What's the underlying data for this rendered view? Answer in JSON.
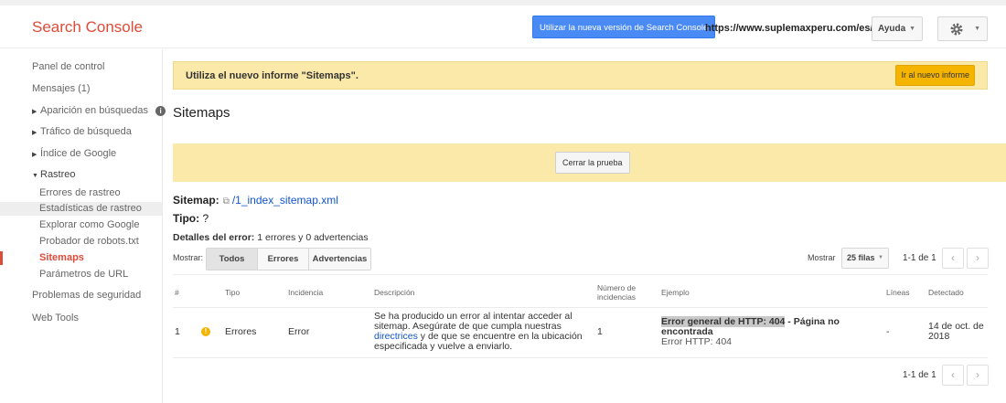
{
  "header": {
    "logo": "Search Console",
    "new_version_button": "Utilizar la nueva versión de Search Console",
    "site_url": "https://www.suplemaxperu.com/es/",
    "help_label": "Ayuda"
  },
  "sidebar": {
    "items": [
      {
        "label": "Panel de control"
      },
      {
        "label": "Mensajes (1)"
      },
      {
        "label": "Aparición en búsquedas"
      },
      {
        "label": "Tráfico de búsqueda"
      },
      {
        "label": "Índice de Google"
      },
      {
        "label": "Rastreo"
      },
      {
        "label": "Problemas de seguridad"
      },
      {
        "label": "Web Tools"
      }
    ],
    "crawl_subitems": [
      {
        "label": "Errores de rastreo"
      },
      {
        "label": "Estadísticas de rastreo"
      },
      {
        "label": "Explorar como Google"
      },
      {
        "label": "Probador de robots.txt"
      },
      {
        "label": "Sitemaps"
      },
      {
        "label": "Parámetros de URL"
      }
    ]
  },
  "banner": {
    "text": "Utiliza el nuevo informe \"Sitemaps\".",
    "button": "Ir al nuevo informe"
  },
  "page_title": "Sitemaps",
  "test_banner": {
    "button": "Cerrar la prueba"
  },
  "sitemap": {
    "label": "Sitemap:",
    "path": "/1_index_sitemap.xml",
    "type_label": "Tipo:",
    "type_value": "?",
    "details_label": "Detalles del error:",
    "details_value": "1 errores y 0 advertencias"
  },
  "filters": {
    "show_label": "Mostrar:",
    "tabs": [
      "Todos",
      "Errores",
      "Advertencias"
    ],
    "rows_label": "Mostrar",
    "rows_value": "25 filas",
    "range": "1-1 de 1"
  },
  "table": {
    "headers": {
      "num": "#",
      "tipo": "Tipo",
      "incidencia": "Incidencia",
      "descripcion": "Descripción",
      "incidencias_1": "Número de",
      "incidencias_2": "incidencias",
      "ejemplo": "Ejemplo",
      "lineas": "Líneas",
      "detectado": "Detectado"
    },
    "row": {
      "num": "1",
      "tipo": "Errores",
      "incidencia": "Error",
      "desc_1": "Se ha producido un error al intentar acceder al",
      "desc_2": "sitemap. Asegúrate de que cumpla nuestras",
      "desc_link": "directrices",
      "desc_3": " y de que se encuentre en la ubicación",
      "desc_4": "especificada y vuelve a enviarlo.",
      "count": "1",
      "example_highlight": "Error general de HTTP: 404",
      "example_rest": " - Página no",
      "example_2": "encontrada",
      "example_sub": "Error HTTP: 404",
      "lines": "-",
      "detected_1": "14 de oct. de",
      "detected_2": "2018"
    }
  },
  "colors": {
    "brand": "#dd4b39",
    "banner": "#fae9a8",
    "primary": "#4a8af4",
    "link": "#1155cc"
  }
}
